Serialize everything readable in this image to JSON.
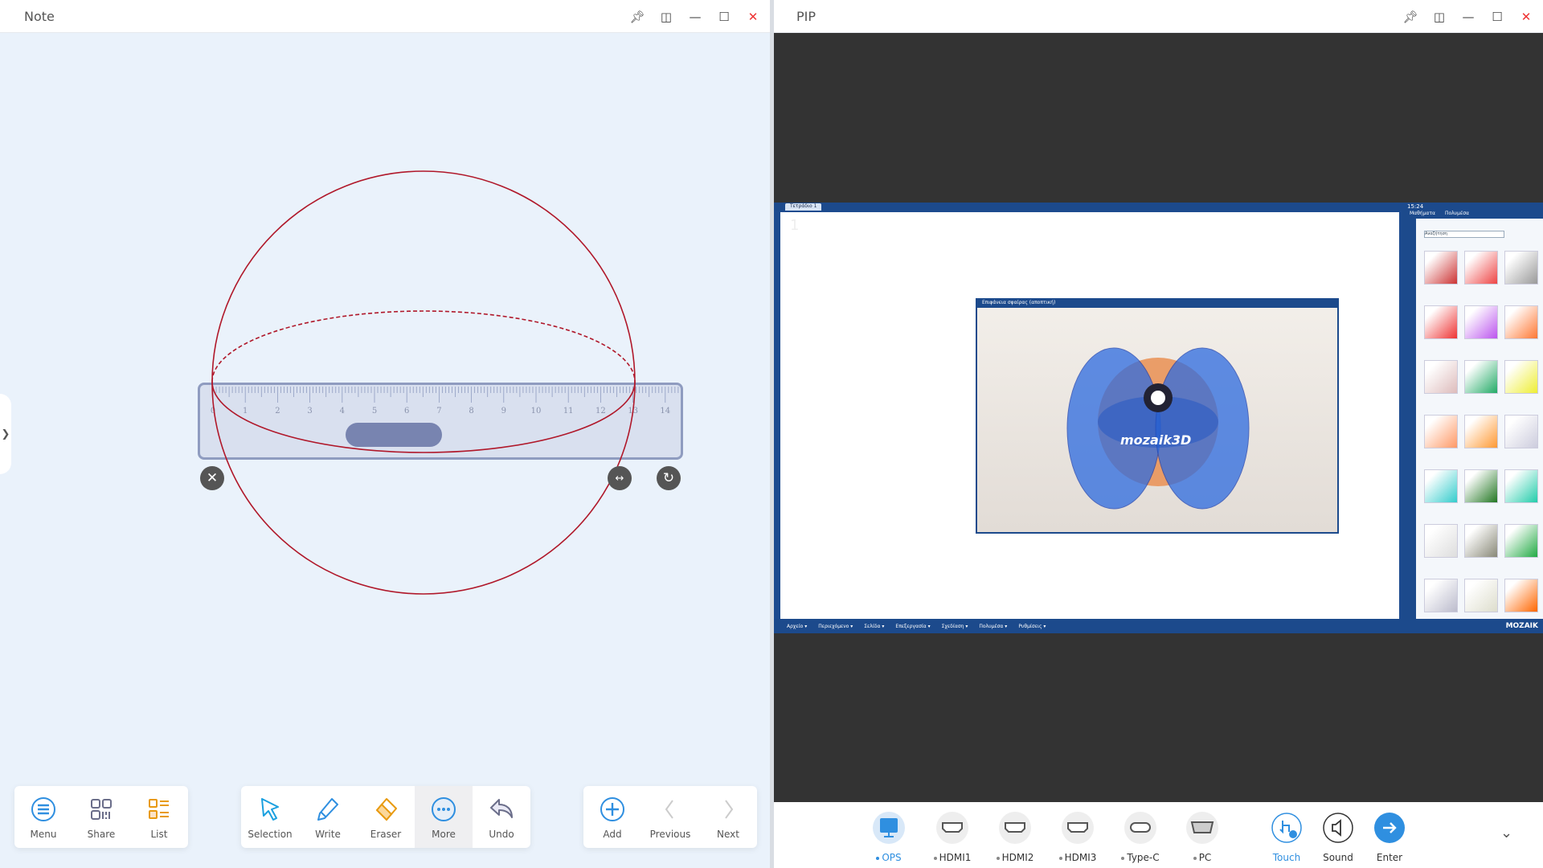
{
  "note": {
    "title": "Note",
    "ruler_labels": [
      "0",
      "1",
      "2",
      "3",
      "4",
      "5",
      "6",
      "7",
      "8",
      "9",
      "10",
      "11",
      "12",
      "13",
      "14"
    ],
    "toolbar_left": [
      {
        "label": "Menu",
        "icon": "menu-icon"
      },
      {
        "label": "Share",
        "icon": "qr-share-icon"
      },
      {
        "label": "List",
        "icon": "list-icon"
      }
    ],
    "toolbar_center": [
      {
        "label": "Selection",
        "icon": "cursor-icon"
      },
      {
        "label": "Write",
        "icon": "pen-icon"
      },
      {
        "label": "Eraser",
        "icon": "eraser-icon"
      },
      {
        "label": "More",
        "icon": "more-icon",
        "active": true
      },
      {
        "label": "Undo",
        "icon": "undo-icon"
      }
    ],
    "toolbar_right": [
      {
        "label": "Add",
        "icon": "plus-icon"
      },
      {
        "label": "Previous",
        "icon": "chevron-left-icon"
      },
      {
        "label": "Next",
        "icon": "chevron-right-icon"
      }
    ],
    "stroke_color": "#b0182a"
  },
  "pip": {
    "title": "PIP",
    "mozaik": {
      "tab": "Τετράδιο 1",
      "page_number": "1",
      "clock": "15:24",
      "window_title": "Επιφάνεια σφαίρας (αποπτική)",
      "logo": "mozaik3D",
      "side_tabs": [
        "Μαθήματα",
        "Πολυμέσα"
      ],
      "search_placeholder": "Αναζήτηση",
      "menu": [
        "Αρχείο ▾",
        "Περιεχόμενο ▾",
        "Σελίδα ▾",
        "Επεξεργασία ▾",
        "Σχεδίαση ▾",
        "Πολυμέσα ▾",
        "Ρυθμίσεις ▾"
      ],
      "brand": "MOZAIK"
    },
    "sources": [
      {
        "label": "OPS",
        "icon": "ops-icon",
        "active": true
      },
      {
        "label": "HDMI1",
        "icon": "hdmi-icon"
      },
      {
        "label": "HDMI2",
        "icon": "hdmi-icon"
      },
      {
        "label": "HDMI3",
        "icon": "hdmi-icon"
      },
      {
        "label": "Type-C",
        "icon": "usb-c-icon"
      },
      {
        "label": "PC",
        "icon": "vga-icon"
      }
    ],
    "actions": [
      {
        "label": "Touch",
        "icon": "touch-icon",
        "active": true
      },
      {
        "label": "Sound",
        "icon": "speaker-icon"
      },
      {
        "label": "Enter",
        "icon": "arrow-right-icon"
      }
    ],
    "accent": "#2f8fe0"
  }
}
